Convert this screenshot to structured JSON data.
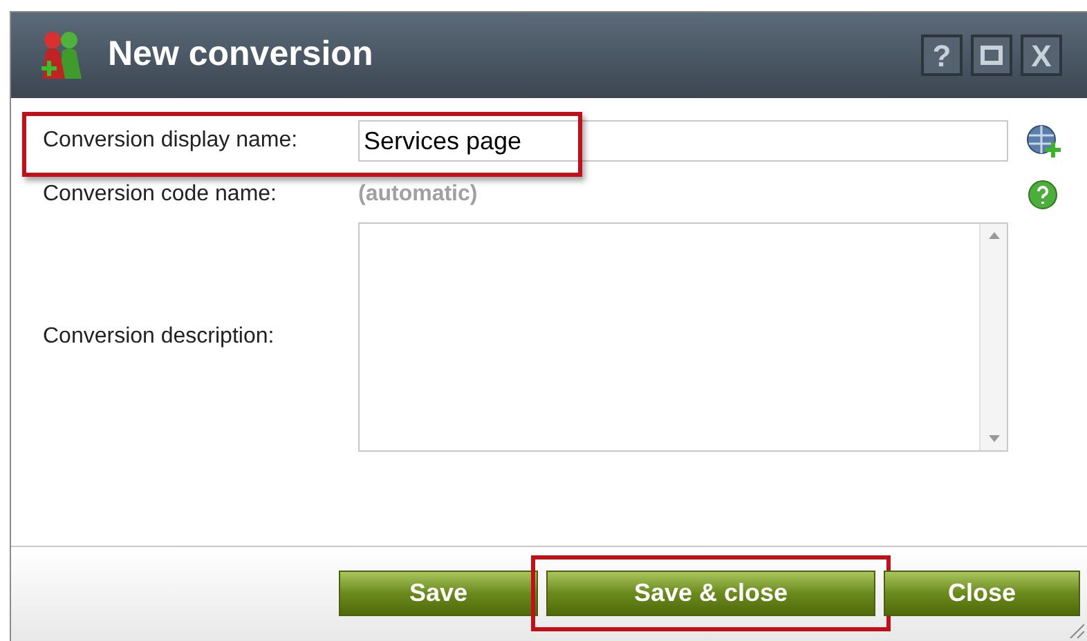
{
  "window": {
    "title": "New conversion",
    "title_buttons": [
      {
        "kind": "text",
        "label": "?"
      },
      {
        "kind": "maximize"
      },
      {
        "kind": "text",
        "label": "X"
      }
    ]
  },
  "form": {
    "display_name": {
      "label": "Conversion display name:",
      "value": "Services page",
      "highlighted": true
    },
    "code_name": {
      "label": "Conversion code name:",
      "value": "(automatic)"
    },
    "description": {
      "label": "Conversion description:"
    }
  },
  "buttons": [
    {
      "label": "Save",
      "highlighted": false
    },
    {
      "label": "Save & close",
      "highlighted": true
    },
    {
      "label": "Close",
      "highlighted": false
    }
  ]
}
